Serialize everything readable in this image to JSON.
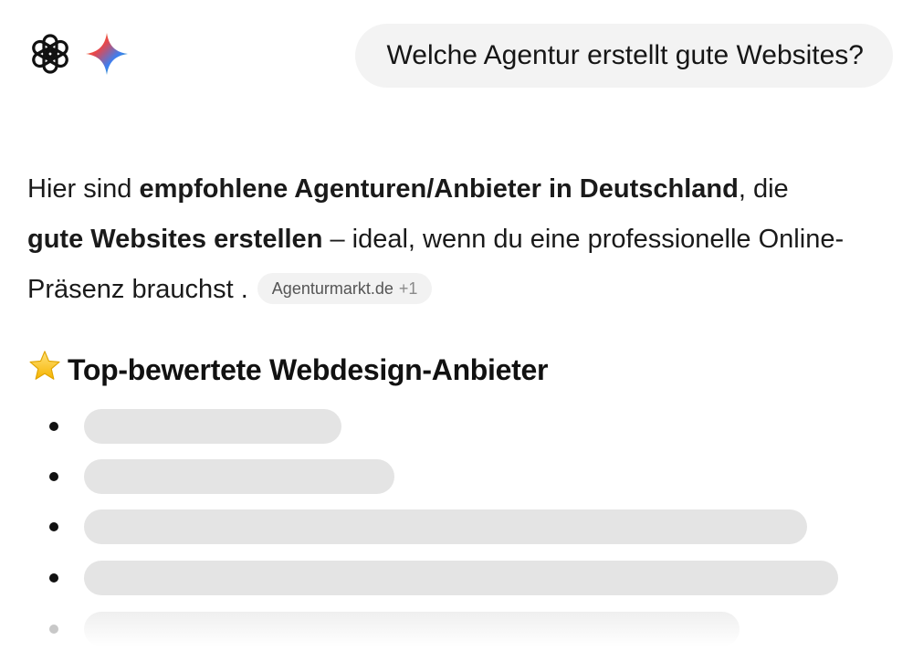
{
  "header": {
    "icons": [
      "openai-logo",
      "gemini-sparkle"
    ]
  },
  "user_message": "Welche Agentur erstellt gute Websites?",
  "answer": {
    "p1": "Hier sind ",
    "b1": "empfohlene Agenturen/Anbieter in Deutschland",
    "p2": ", die ",
    "b2": "gute Websites erstellen",
    "p3": " – ideal, wenn du eine professionelle Online-Präsenz brauchst .",
    "source_chip": {
      "label": "Agenturmarkt.de",
      "extra": "+1"
    }
  },
  "section": {
    "star_icon": "star-emoji",
    "title": "Top-bewertete Webdesign-Anbieter"
  },
  "loading_rows": 5,
  "colors": {
    "bubble_bg": "#f3f3f3",
    "placeholder": "#e4e4e4",
    "text": "#111111"
  }
}
